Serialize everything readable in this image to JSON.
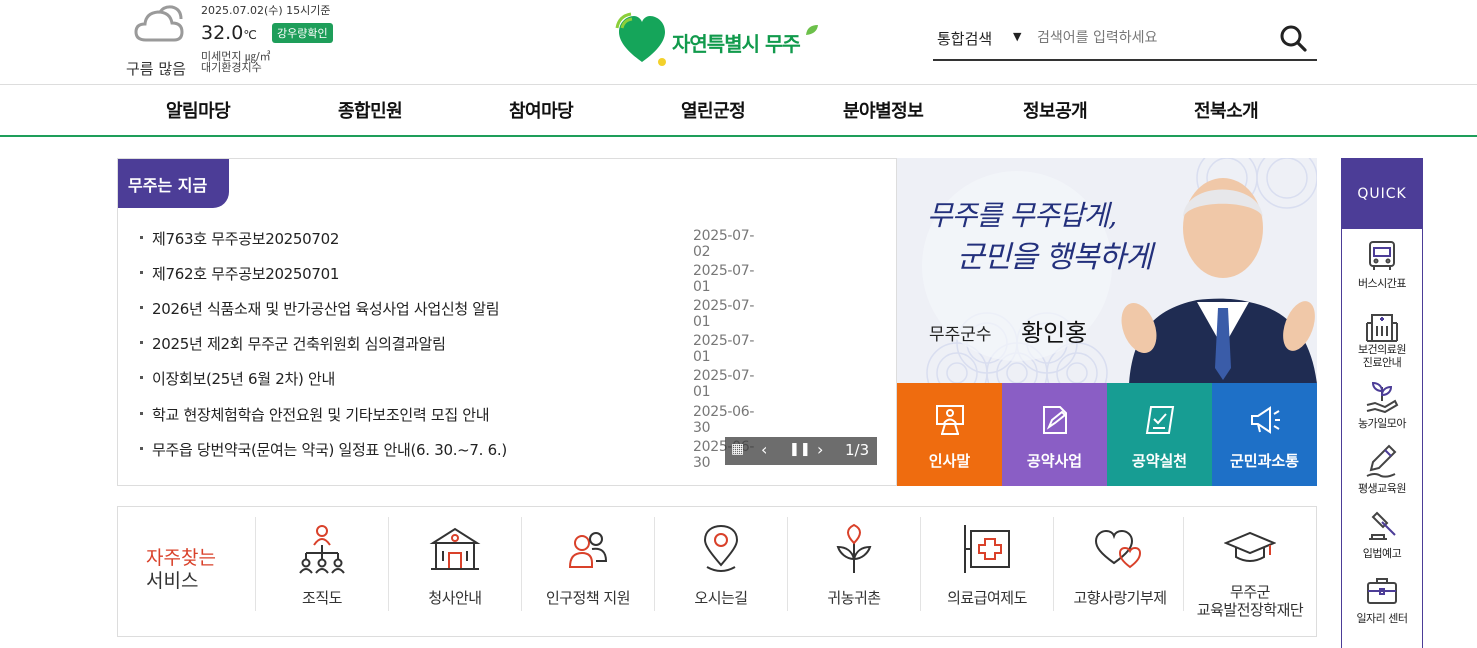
{
  "weather": {
    "date": "2025.07.02(수) 15시기준",
    "temp": "32.0",
    "temp_unit": "℃",
    "condition": "구름 많음",
    "rain_button": "강우량확인",
    "dust": "미세먼지 ㎍/㎥",
    "air_index": "대기환경지수"
  },
  "logo": {
    "text": "자연특별시 무주"
  },
  "search": {
    "scope": "통합검색",
    "placeholder": "검색어를 입력하세요"
  },
  "gnb": [
    "알림마당",
    "종합민원",
    "참여마당",
    "열린군정",
    "분야별정보",
    "정보공개",
    "전북소개"
  ],
  "news": {
    "tab": "무주는 지금",
    "items": [
      {
        "title": "제763호 무주공보20250702",
        "date": "2025-07-02"
      },
      {
        "title": "제762호 무주공보20250701",
        "date": "2025-07-01"
      },
      {
        "title": "2026년 식품소재 및 반가공산업 육성사업 사업신청 알림",
        "date": "2025-07-01"
      },
      {
        "title": "2025년 제2회 무주군 건축위원회 심의결과알림",
        "date": "2025-07-01"
      },
      {
        "title": "이장회보(25년 6월 2차) 안내",
        "date": "2025-07-01"
      },
      {
        "title": "학교 현장체험학습 안전요원 및 기타보조인력 모집 안내",
        "date": "2025-06-30"
      },
      {
        "title": "무주읍 당번약국(문여는 약국) 일정표 안내(6. 30.~7. 6.)",
        "date": "2025-06-30"
      }
    ],
    "pager": "1/3"
  },
  "governor": {
    "slogan_line1": "무주를 무주답게,",
    "slogan_line2": "군민을 행복하게",
    "title": "무주군수",
    "name": "황인홍",
    "tiles": [
      {
        "label": "인사말",
        "color": "#ef6c0f",
        "icon": "podium-icon"
      },
      {
        "label": "공약사업",
        "color": "#8a5ec5",
        "icon": "document-edit-icon"
      },
      {
        "label": "공약실천",
        "color": "#179d93",
        "icon": "checklist-icon"
      },
      {
        "label": "군민과소통",
        "color": "#1e70c7",
        "icon": "megaphone-icon"
      }
    ]
  },
  "services": {
    "heading_line1": "자주찾는",
    "heading_line2": "서비스",
    "items": [
      {
        "label": "조직도",
        "icon": "org-chart-icon"
      },
      {
        "label": "청사안내",
        "icon": "building-icon"
      },
      {
        "label": "인구정책 지원",
        "icon": "people-icon"
      },
      {
        "label": "오시는길",
        "icon": "location-pin-icon"
      },
      {
        "label": "귀농귀촌",
        "icon": "sprout-icon"
      },
      {
        "label": "의료급여제도",
        "icon": "medical-cross-icon"
      },
      {
        "label": "고향사랑기부제",
        "icon": "hearts-icon"
      },
      {
        "label": "무주군\n교육발전장학재단",
        "icon": "graduation-cap-icon"
      }
    ]
  },
  "quick": {
    "heading": "QUICK",
    "items": [
      {
        "label": "버스시간표",
        "icon": "bus-icon"
      },
      {
        "label": "보건의료원\n진료안내",
        "icon": "hospital-icon"
      },
      {
        "label": "농가일모아",
        "icon": "plant-hand-icon"
      },
      {
        "label": "평생교육원",
        "icon": "pen-icon"
      },
      {
        "label": "입법예고",
        "icon": "gavel-icon"
      },
      {
        "label": "일자리 센터",
        "icon": "briefcase-icon"
      }
    ]
  },
  "colors": {
    "brand_green": "#1e9e5a",
    "brand_purple": "#4c3d97",
    "accent_red": "#d9412a"
  }
}
